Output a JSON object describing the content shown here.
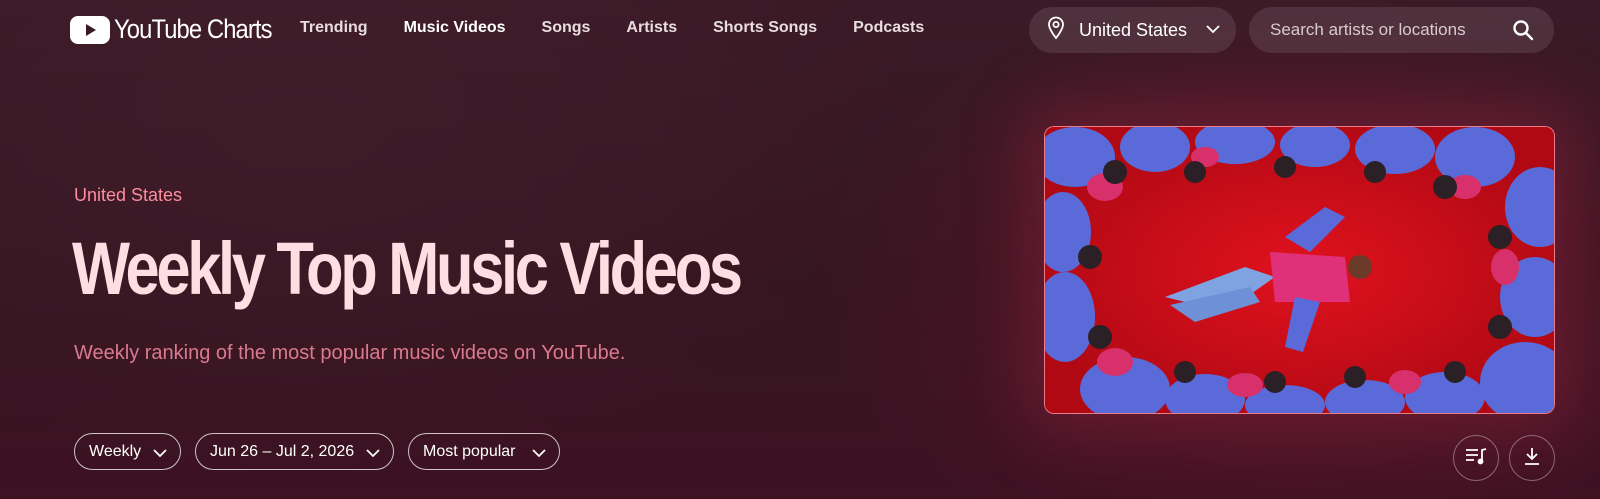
{
  "brand": {
    "name": "YouTube Charts"
  },
  "nav": {
    "items": [
      {
        "label": "Trending"
      },
      {
        "label": "Music Videos",
        "active": true
      },
      {
        "label": "Songs"
      },
      {
        "label": "Artists"
      },
      {
        "label": "Shorts Songs"
      },
      {
        "label": "Podcasts"
      }
    ]
  },
  "location_select": {
    "value": "United States",
    "icon": "location-pin-icon"
  },
  "search": {
    "placeholder": "Search artists or locations",
    "icon": "search-icon"
  },
  "hero": {
    "country": "United States",
    "title": "Weekly Top Music Videos",
    "subtitle": "Weekly ranking of the most popular music videos on YouTube."
  },
  "filters": {
    "period": "Weekly",
    "date_range": "Jun 26 – Jul 2, 2026",
    "sort": "Most popular"
  },
  "actions": {
    "playlist_icon": "playlist-music-icon",
    "download_icon": "download-icon"
  },
  "colors": {
    "accent": "#ff8c9e",
    "title": "#ffdde2",
    "subtitle": "#d97a8f",
    "background": "#351520"
  }
}
